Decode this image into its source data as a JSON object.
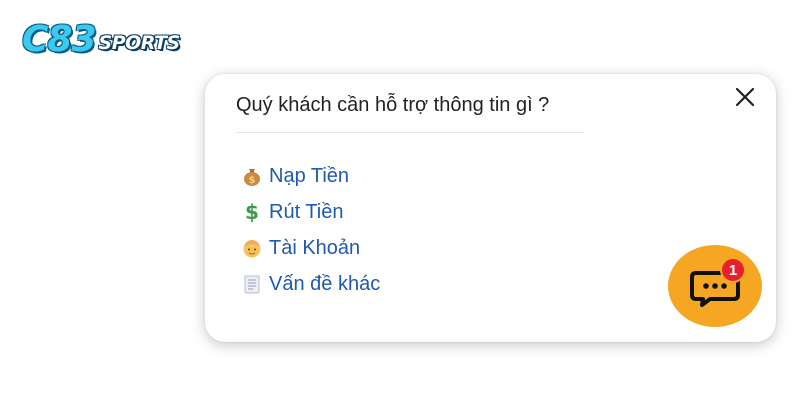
{
  "brand": {
    "logo_main": "C83",
    "logo_sub": "SPORTS"
  },
  "popup": {
    "title": "Quý khách cần hỗ trợ thông tin gì ?",
    "close_icon": "close-icon",
    "items": [
      {
        "icon": "money-bag-icon",
        "label": "Nạp Tiền"
      },
      {
        "icon": "dollar-sign-icon",
        "label": "Rút Tiền"
      },
      {
        "icon": "person-icon",
        "label": "Tài Khoản"
      },
      {
        "icon": "document-icon",
        "label": "Vấn đề khác"
      }
    ]
  },
  "chat": {
    "icon": "chat-bubble-icon",
    "badge_count": "1",
    "colors": {
      "button": "#f5a623",
      "badge": "#e6212c"
    }
  },
  "colors": {
    "link": "#1d5ab0",
    "logo": "#3cc9f0"
  }
}
